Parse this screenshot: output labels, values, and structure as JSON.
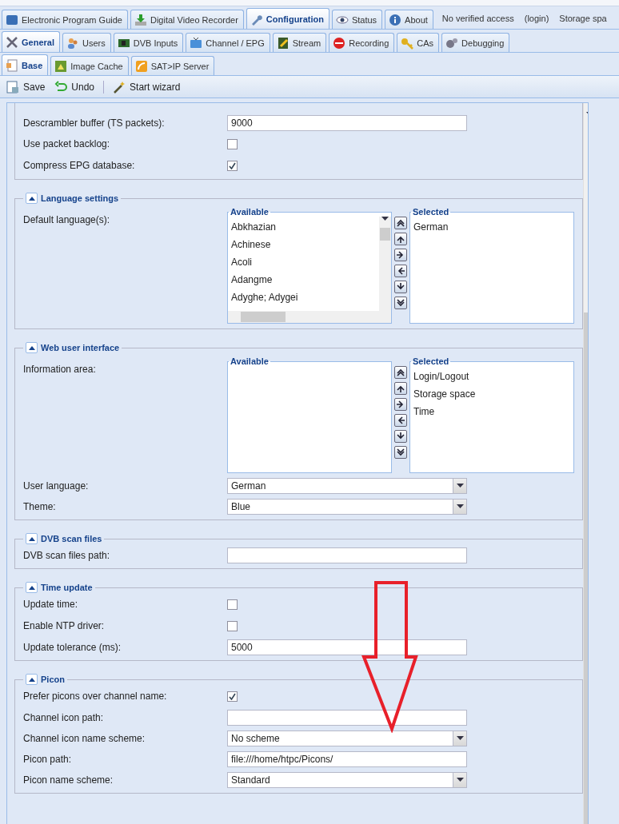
{
  "main_tabs": [
    {
      "label": "Electronic Program Guide",
      "selected": false
    },
    {
      "label": "Digital Video Recorder",
      "selected": false
    },
    {
      "label": "Configuration",
      "selected": true
    },
    {
      "label": "Status",
      "selected": false
    },
    {
      "label": "About",
      "selected": false
    }
  ],
  "info_area": [
    "No verified access",
    "(login)",
    "Storage spa"
  ],
  "sub_tabs": [
    {
      "label": "General",
      "selected": true
    },
    {
      "label": "Users",
      "selected": false
    },
    {
      "label": "DVB Inputs",
      "selected": false
    },
    {
      "label": "Channel / EPG",
      "selected": false
    },
    {
      "label": "Stream",
      "selected": false
    },
    {
      "label": "Recording",
      "selected": false
    },
    {
      "label": "CAs",
      "selected": false
    },
    {
      "label": "Debugging",
      "selected": false
    }
  ],
  "inner_tabs": [
    {
      "label": "Base",
      "selected": true
    },
    {
      "label": "Image Cache",
      "selected": false
    },
    {
      "label": "SAT>IP Server",
      "selected": false
    }
  ],
  "toolbar": [
    {
      "label": "Save"
    },
    {
      "label": "Undo"
    },
    {
      "label": "Start wizard"
    }
  ],
  "sections": [
    {
      "rows": [
        {
          "kind": "text",
          "label": "Descrambler buffer (TS packets):",
          "value": "9000"
        },
        {
          "kind": "checkbox",
          "label": "Use packet backlog:",
          "checked": false
        },
        {
          "kind": "checkbox",
          "label": "Compress EPG database:",
          "checked": true
        }
      ]
    },
    {
      "title": "Language settings",
      "expanded": true,
      "rows": [
        {
          "kind": "duallist",
          "label": "Default language(s):",
          "available_title": "Available",
          "available": [
            "Abkhazian",
            "Achinese",
            "Acoli",
            "Adangme",
            "Adyghe; Adygei"
          ],
          "selected_title": "Selected",
          "selected_items": [
            "German"
          ]
        }
      ]
    },
    {
      "title": "Web user interface",
      "expanded": true,
      "rows": [
        {
          "kind": "duallist",
          "label": "Information area:",
          "available_title": "Available",
          "available": [],
          "selected_title": "Selected",
          "selected_items": [
            "Login/Logout",
            "Storage space",
            "Time"
          ]
        },
        {
          "kind": "select",
          "label": "User language:",
          "value": "German"
        },
        {
          "kind": "select",
          "label": "Theme:",
          "value": "Blue"
        }
      ]
    },
    {
      "title": "DVB scan files",
      "expanded": true,
      "rows": [
        {
          "kind": "text",
          "label": "DVB scan files path:"
        }
      ]
    },
    {
      "title": "Time update",
      "expanded": true,
      "rows": [
        {
          "kind": "checkbox",
          "label": "Update time:",
          "checked": false
        },
        {
          "kind": "checkbox",
          "label": "Enable NTP driver:",
          "checked": false
        },
        {
          "kind": "text",
          "label": "Update tolerance (ms):",
          "value": "5000"
        }
      ]
    },
    {
      "title": "Picon",
      "expanded": true,
      "rows": [
        {
          "kind": "checkbox",
          "label": "Prefer picons over channel name:",
          "checked": true
        },
        {
          "kind": "text",
          "label": "Channel icon path:"
        },
        {
          "kind": "select",
          "label": "Channel icon name scheme:",
          "value": "No scheme"
        },
        {
          "kind": "text",
          "label": "Picon path:",
          "value": "file:///home/htpc/Picons/"
        },
        {
          "kind": "select",
          "label": "Picon name scheme:",
          "value": "Standard"
        }
      ]
    }
  ]
}
